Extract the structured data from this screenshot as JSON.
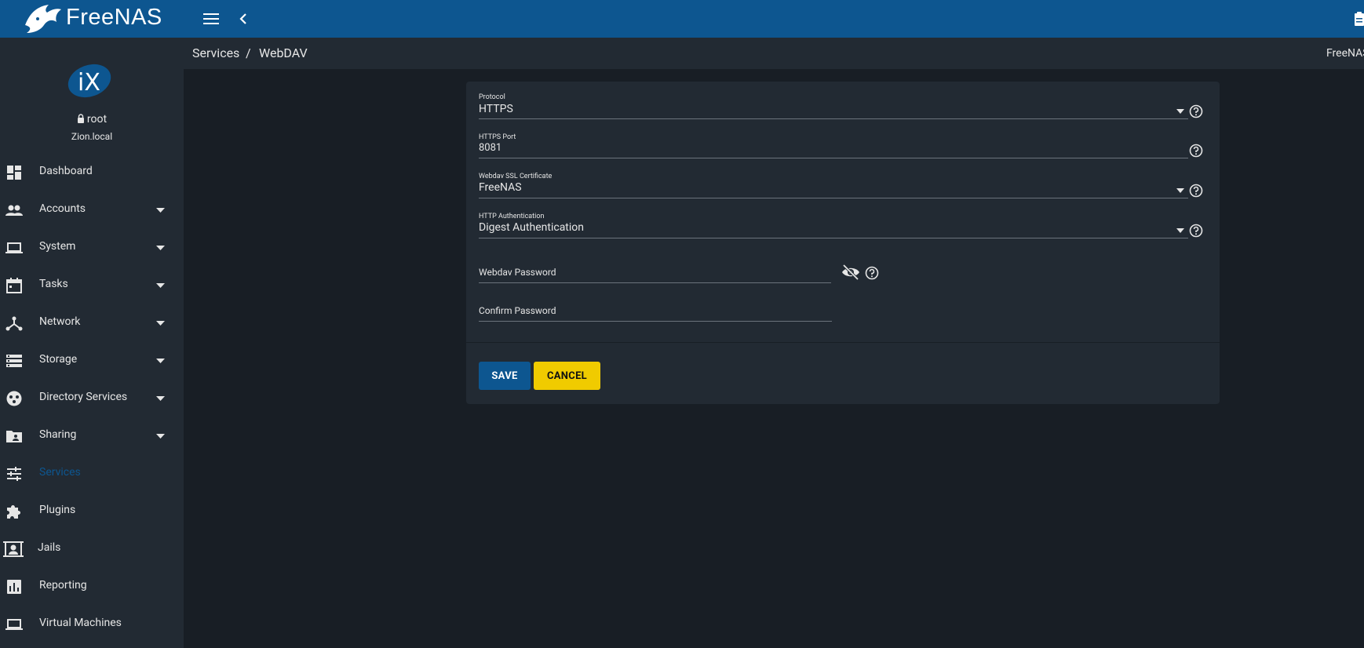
{
  "app": {
    "name": "FreeNAS",
    "tm": "™"
  },
  "user": {
    "name": "root",
    "host": "Zion.local"
  },
  "sidebar": {
    "items": [
      {
        "label": "Dashboard",
        "icon": "dashboard-icon"
      },
      {
        "label": "Accounts",
        "icon": "people-icon"
      },
      {
        "label": "System",
        "icon": "laptop-icon"
      },
      {
        "label": "Tasks",
        "icon": "calendar-icon"
      },
      {
        "label": "Network",
        "icon": "network-icon"
      },
      {
        "label": "Storage",
        "icon": "storage-icon"
      },
      {
        "label": "Directory Services",
        "icon": "directory-icon"
      },
      {
        "label": "Sharing",
        "icon": "shared-folder-icon"
      },
      {
        "label": "Services",
        "icon": "tune-icon",
        "active": true
      },
      {
        "label": "Plugins",
        "icon": "puzzle-icon"
      },
      {
        "label": "Jails",
        "icon": "jail-icon"
      },
      {
        "label": "Reporting",
        "icon": "chart-icon"
      },
      {
        "label": "Virtual Machines",
        "icon": "laptop-icon"
      }
    ]
  },
  "breadcrumb": {
    "parent": "Services",
    "separator": "/",
    "current": "WebDAV",
    "right": "FreeNAS"
  },
  "form": {
    "protocol": {
      "label": "Protocol",
      "value": "HTTPS"
    },
    "https_port": {
      "label": "HTTPS Port",
      "value": "8081"
    },
    "certificate": {
      "label": "Webdav SSL Certificate",
      "value": "FreeNAS"
    },
    "auth": {
      "label": "HTTP Authentication",
      "value": "Digest Authentication"
    },
    "password": {
      "placeholder": "Webdav Password"
    },
    "confirm": {
      "placeholder": "Confirm Password"
    },
    "save_label": "SAVE",
    "cancel_label": "CANCEL"
  },
  "colors": {
    "accent": "#0d5690",
    "cancel": "#f0cb00",
    "sidebar": "#222a33",
    "background": "#181e25"
  }
}
